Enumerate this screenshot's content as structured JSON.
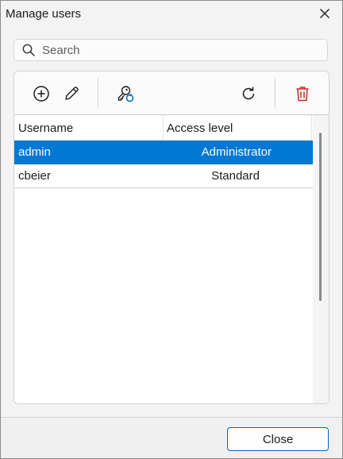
{
  "window": {
    "title": "Manage users"
  },
  "search": {
    "placeholder": "Search"
  },
  "toolbar": {
    "icons": [
      "add-icon",
      "edit-icon",
      "key-reset-icon",
      "refresh-icon",
      "delete-icon"
    ],
    "delete_color": "#c42b1c"
  },
  "table": {
    "columns": [
      "Username",
      "Access level"
    ],
    "rows": [
      {
        "username": "admin",
        "access": "Administrator",
        "selected": true
      },
      {
        "username": "cbeier",
        "access": "Standard",
        "selected": false
      }
    ],
    "selection_color": "#0078d4"
  },
  "footer": {
    "close_label": "Close"
  }
}
